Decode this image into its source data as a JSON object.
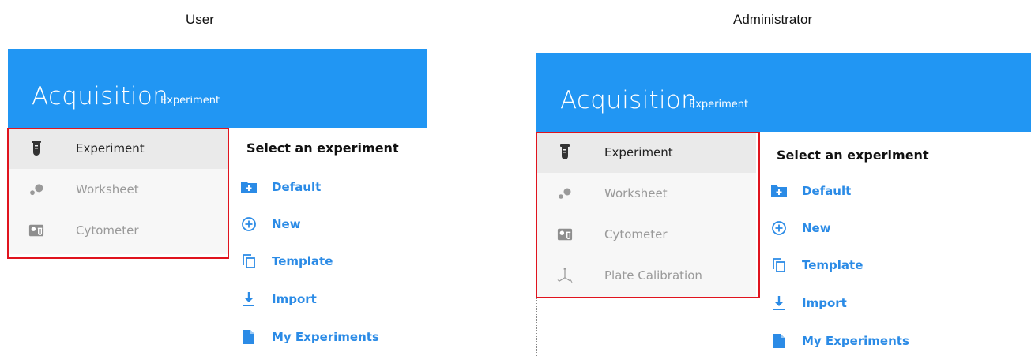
{
  "captions": {
    "left": "User",
    "right": "Administrator"
  },
  "app": {
    "title": "Acquisition",
    "subtitle": "Experiment"
  },
  "user_panel": {
    "nav": [
      {
        "label": "Experiment",
        "icon": "test-tube-icon",
        "active": true
      },
      {
        "label": "Worksheet",
        "icon": "dots-icon",
        "active": false
      },
      {
        "label": "Cytometer",
        "icon": "cytometer-icon",
        "active": false
      }
    ]
  },
  "admin_panel": {
    "nav": [
      {
        "label": "Experiment",
        "icon": "test-tube-icon",
        "active": true
      },
      {
        "label": "Worksheet",
        "icon": "dots-icon",
        "active": false
      },
      {
        "label": "Cytometer",
        "icon": "cytometer-icon",
        "active": false
      },
      {
        "label": "Plate Calibration",
        "icon": "axes-icon",
        "active": false
      }
    ]
  },
  "content": {
    "heading": "Select an experiment",
    "actions": [
      {
        "label": "Default",
        "icon": "folder-plus-icon"
      },
      {
        "label": "New",
        "icon": "circle-plus-icon"
      },
      {
        "label": "Template",
        "icon": "copy-icon"
      },
      {
        "label": "Import",
        "icon": "download-icon"
      },
      {
        "label": "My Experiments",
        "icon": "document-icon"
      }
    ]
  },
  "colors": {
    "header": "#2196f3",
    "accent": "#2b8be6",
    "highlight": "#e0141e"
  }
}
